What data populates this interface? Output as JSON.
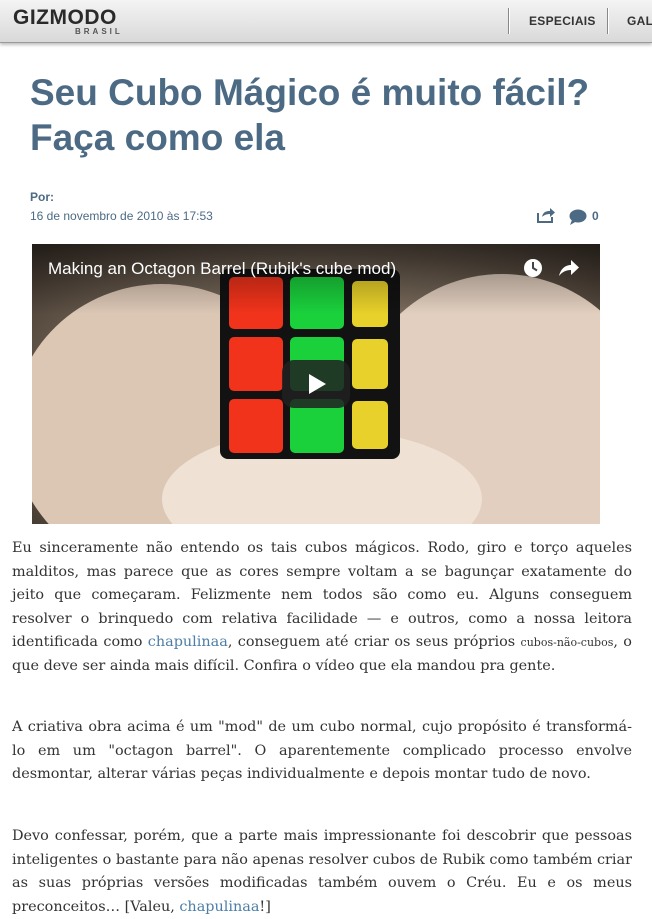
{
  "header": {
    "logo_main": "GIZMODO",
    "logo_sub": "BRASIL",
    "nav": [
      "ESPECIAIS",
      "GALE"
    ]
  },
  "article": {
    "title": "Seu Cubo Mágico é muito fácil? Faça como ela",
    "byline": "Por:",
    "date": "16 de novembro de 2010 às 17:53",
    "comment_count": "0",
    "video": {
      "title": "Making an Octagon Barrel (Rubik's cube mod)",
      "icons": [
        "clock-icon",
        "share-arrow-icon",
        "play-icon"
      ]
    },
    "p1": {
      "a": "Eu sinceramente não entendo os tais cubos mágicos. Rodo, giro e torço aqueles malditos, mas parece que as cores sempre voltam a se bagunçar exatamente do jeito que começaram. Felizmente nem todos são como eu. Alguns conseguem resolver o brinquedo com relativa facilidade — e outros, como a nossa leitora identificada como ",
      "link": "chapulinaa",
      "b": ", conseguem até criar os seus próprios ",
      "small": "cubos-não-cubos",
      "c": ", o que deve ser ainda mais difícil. Confira o vídeo que ela mandou pra gente."
    },
    "p2": "A criativa obra acima é um \"mod\" de um cubo normal, cujo propósito é transformá-lo em um \"octagon barrel\". O aparentemente complicado processo envolve desmontar, alterar várias peças individualmente e depois montar tudo de novo.",
    "p3": {
      "a": "Devo confessar, porém, que a parte mais impressionante foi descobrir que pessoas inteligentes o bastante para não apenas resolver cubos de Rubik como também criar as suas próprias versões modificadas também ouvem o Créu. Eu e os meus preconceitos… [Valeu, ",
      "link": "chapulinaa",
      "b": "!]"
    }
  },
  "colors": {
    "title": "#4c6a84",
    "link": "#4c7ea8",
    "body_text": "#333333"
  }
}
